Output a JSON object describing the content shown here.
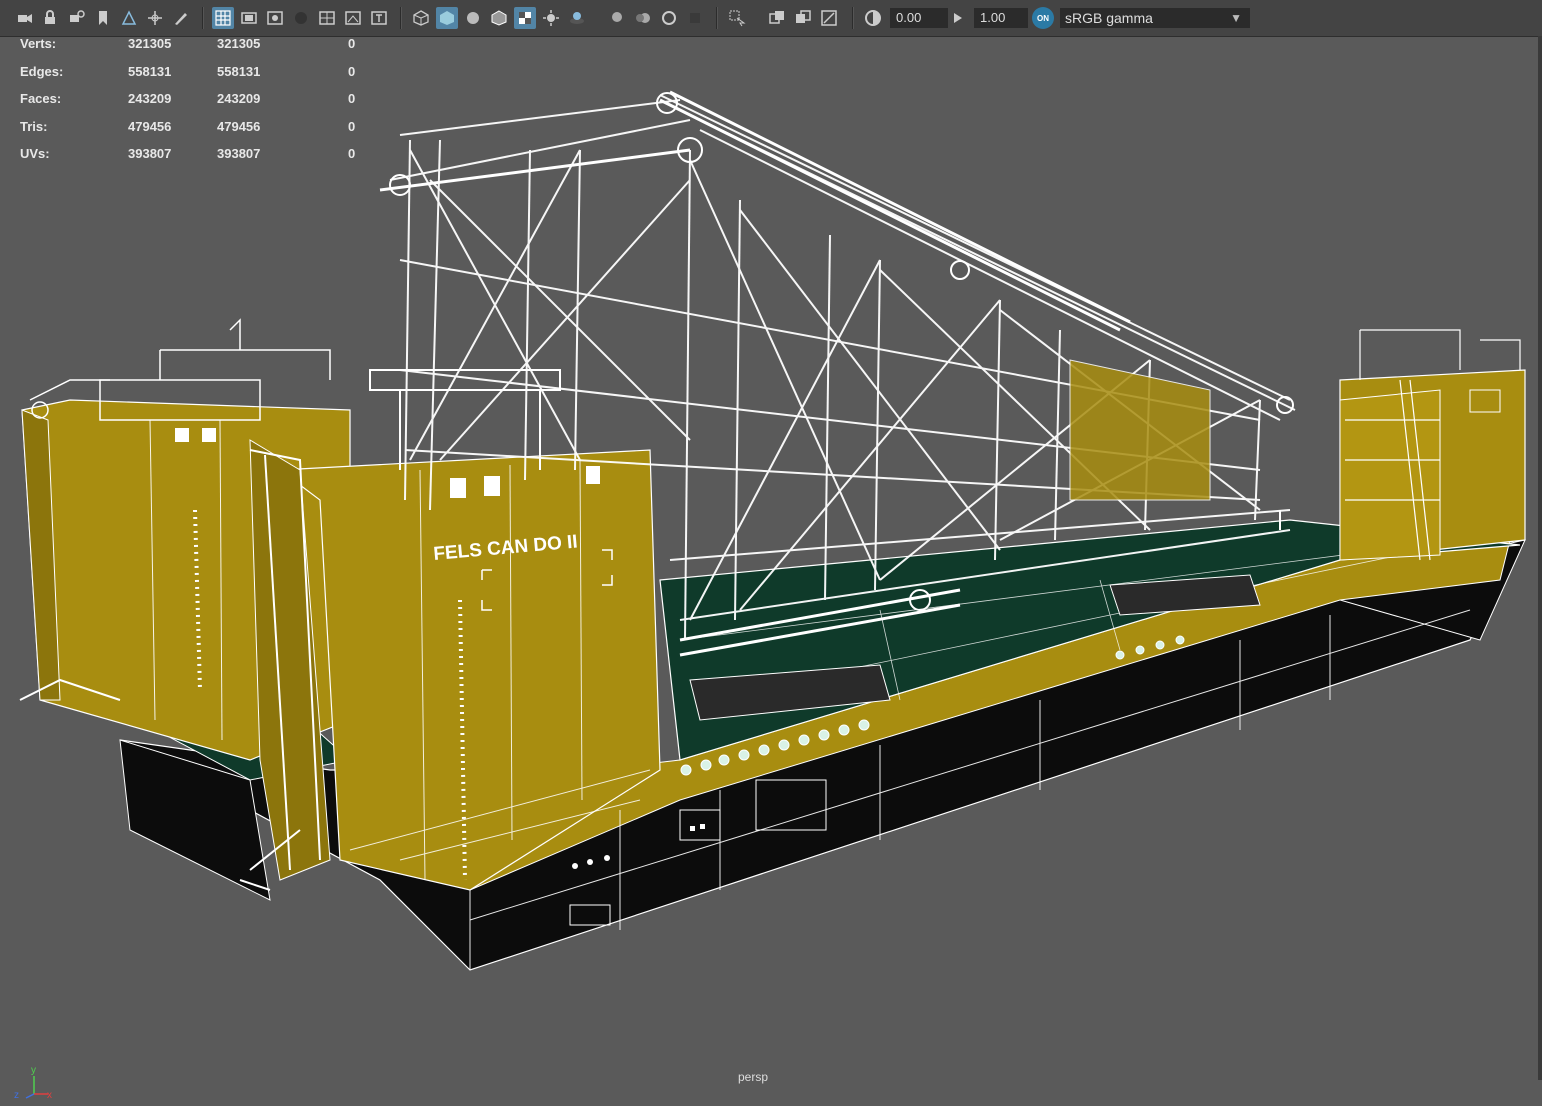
{
  "toolbar": {
    "exposure_value": "0.00",
    "gamma_value": "1.00",
    "color_management_badge": "ON",
    "color_space": "sRGB gamma"
  },
  "hud": {
    "rows": [
      {
        "label": "Verts:",
        "v1": "321305",
        "v2": "321305",
        "v3": "0"
      },
      {
        "label": "Edges:",
        "v1": "558131",
        "v2": "558131",
        "v3": "0"
      },
      {
        "label": "Faces:",
        "v1": "243209",
        "v2": "243209",
        "v3": "0"
      },
      {
        "label": "Tris:",
        "v1": "479456",
        "v2": "479456",
        "v3": "0"
      },
      {
        "label": "UVs:",
        "v1": "393807",
        "v2": "393807",
        "v3": "0"
      }
    ]
  },
  "viewport": {
    "camera": "persp",
    "hull_text": "FELS CAN DO II",
    "axis_labels": {
      "y": "y",
      "z": "z",
      "x": "x"
    }
  },
  "colors": {
    "background": "#5a5a5a",
    "hull_yellow": "#a88d10",
    "hull_black": "#0c0c0c",
    "deck_green": "#0f3a2a",
    "wire": "#ffffff",
    "toolbar_active": "#5285a6"
  }
}
